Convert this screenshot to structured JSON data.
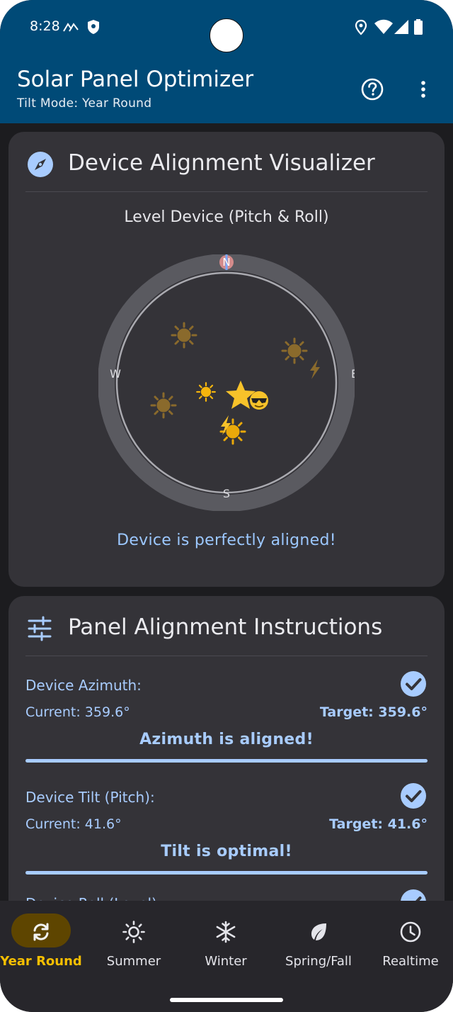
{
  "status": {
    "time": "8:28",
    "icons": [
      "signal-arrows-icon",
      "shield-icon",
      "location-icon",
      "wifi-icon",
      "cell-signal-icon",
      "battery-icon"
    ]
  },
  "app": {
    "title": "Solar Panel Optimizer",
    "subtitle": "Tilt Mode: Year Round",
    "actions": [
      "help-icon",
      "more-vert-icon"
    ]
  },
  "visualizer": {
    "title": "Device Alignment Visualizer",
    "icon": "compass-icon",
    "level_title": "Level Device (Pitch & Roll)",
    "compass": {
      "north": "N",
      "south": "S",
      "east": "E",
      "west": "W"
    },
    "message": "Device is perfectly aligned!"
  },
  "instructions": {
    "title": "Panel Alignment Instructions",
    "icon": "tune-icon",
    "rows": [
      {
        "label": "Device Azimuth:",
        "current": "Current: 359.6°",
        "target": "Target: 359.6°",
        "status": "Azimuth is aligned!"
      },
      {
        "label": "Device Tilt (Pitch):",
        "current": "Current: 41.6°",
        "target": "Target: 41.6°",
        "status": "Tilt is optimal!"
      },
      {
        "label": "Device Roll (Level):"
      }
    ]
  },
  "nav": {
    "items": [
      {
        "label": "Year Round",
        "icon": "sync-icon",
        "active": true
      },
      {
        "label": "Summer",
        "icon": "sun-icon",
        "active": false
      },
      {
        "label": "Winter",
        "icon": "snowflake-icon",
        "active": false
      },
      {
        "label": "Spring/Fall",
        "icon": "leaf-icon",
        "active": false
      },
      {
        "label": "Realtime",
        "icon": "clock-icon",
        "active": false
      }
    ]
  },
  "colors": {
    "app_bar": "#004a77",
    "card": "#343338",
    "accent": "#a8ccff",
    "nav_active": "#f7bf00"
  }
}
